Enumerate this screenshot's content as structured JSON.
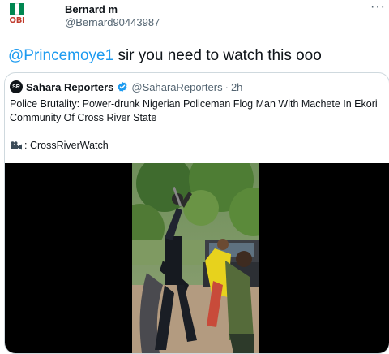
{
  "author": {
    "name": "Bernard m",
    "handle": "@Bernard90443987",
    "avatar_text": "OBI",
    "avatar_flag_colors": [
      "#008751",
      "#ffffff",
      "#008751"
    ]
  },
  "more_icon": "more-options-icon",
  "tweet": {
    "mention": "@Princemoye1",
    "text": " sir you need to watch this ooo"
  },
  "quote": {
    "avatar_text": "SR",
    "name": "Sahara Reporters",
    "handle": "@SaharaReporters",
    "separator": "·",
    "time": "2h",
    "title": "Police Brutality: Power-drunk Nigerian Policeman Flog Man With Machete In Ekori Community Of Cross River State",
    "credit": ": CrossRiverWatch",
    "credit_icon": "movie-camera-icon"
  },
  "colors": {
    "link": "#1d9bf0",
    "verified": "#1d9bf0",
    "secondary_text": "#536471",
    "border": "#cfd9de"
  }
}
